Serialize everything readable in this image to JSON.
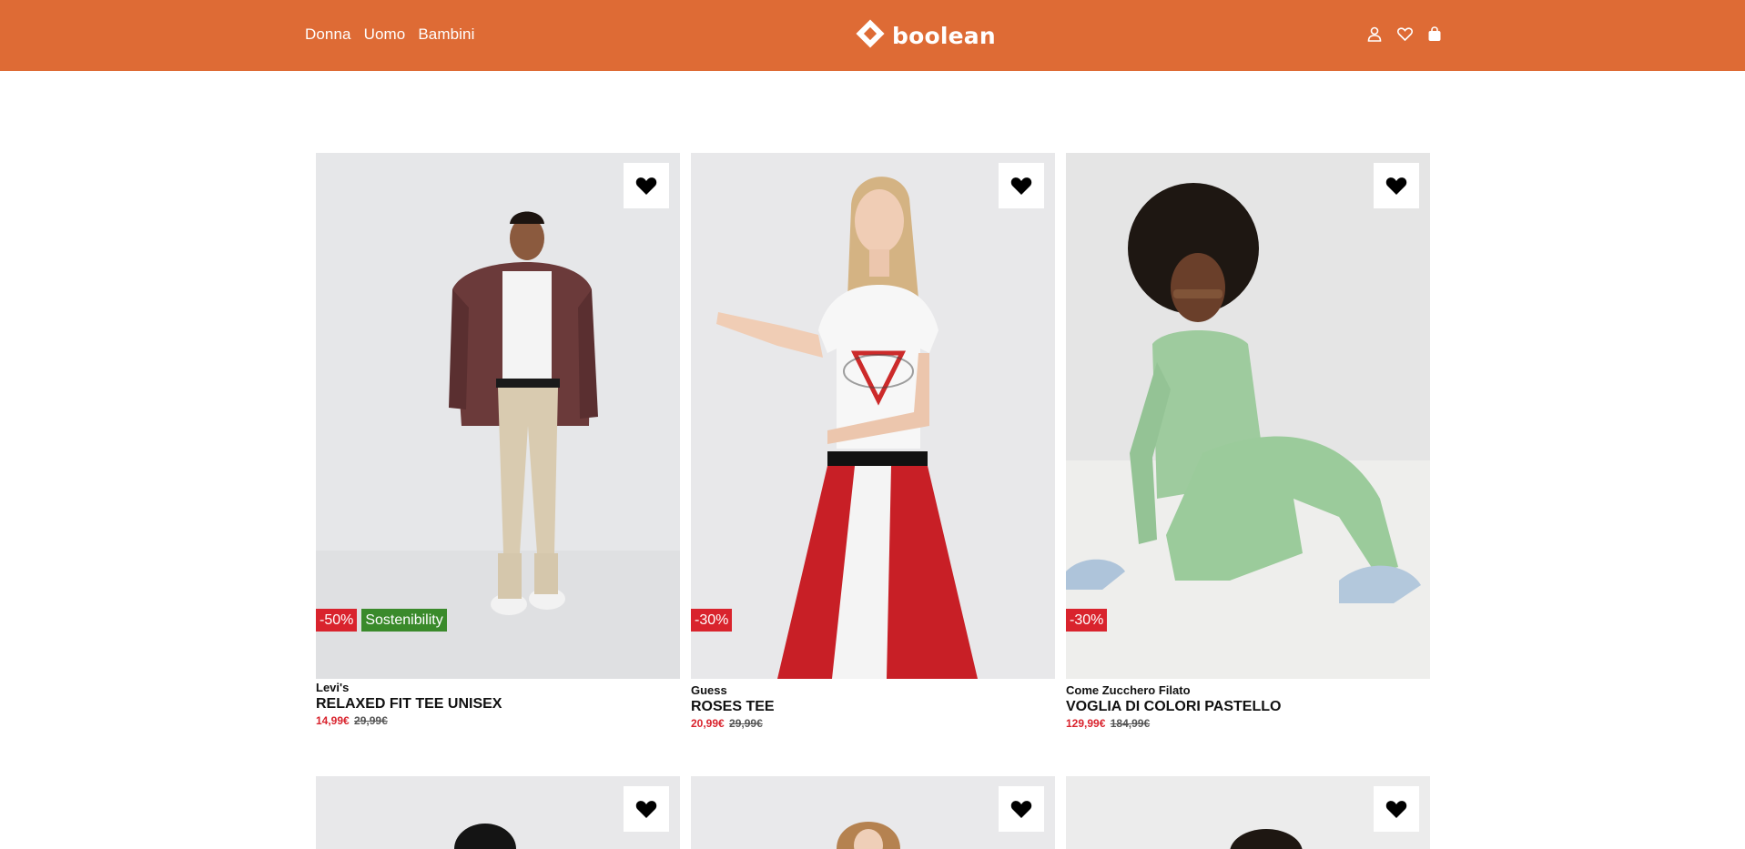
{
  "header": {
    "nav": [
      "Donna",
      "Uomo",
      "Bambini"
    ],
    "logo_text": "boolean",
    "icons": [
      "user-icon",
      "heart-icon",
      "shopping-bag-icon"
    ],
    "accent_color": "#de6b35"
  },
  "products": [
    {
      "brand": "Levi's",
      "name": "RELAXED FIT TEE UNISEX",
      "price": "14,99€",
      "old_price": "29,99€",
      "badges": [
        "-50%",
        "Sostenibility"
      ]
    },
    {
      "brand": "Guess",
      "name": "ROSES TEE",
      "price": "20,99€",
      "old_price": "29,99€",
      "badges": [
        "-30%"
      ]
    },
    {
      "brand": "Come Zucchero Filato",
      "name": "VOGLIA DI COLORI PASTELLO",
      "price": "129,99€",
      "old_price": "184,99€",
      "badges": [
        "-30%"
      ]
    }
  ],
  "wishlist_icon": "heart-icon",
  "colors": {
    "sale": "#d9232d",
    "eco": "#3a8a2b"
  }
}
